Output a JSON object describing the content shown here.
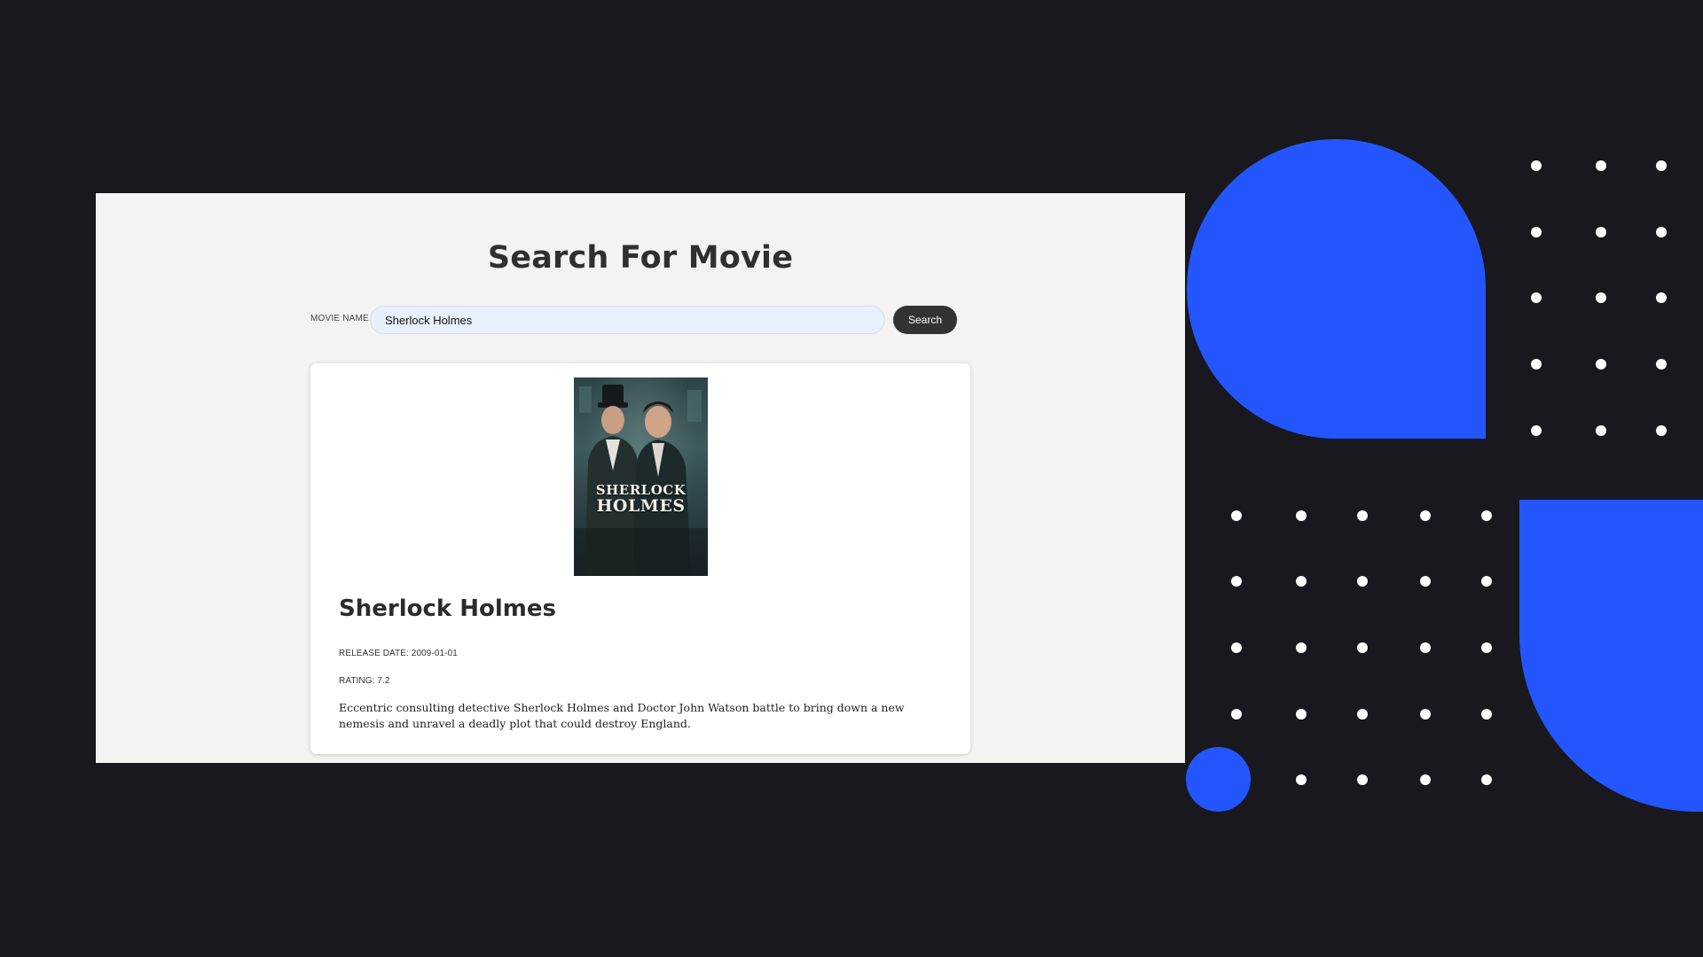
{
  "page": {
    "title": "Search For Movie"
  },
  "search": {
    "label": "MOVIE NAME",
    "value": "Sherlock Holmes",
    "button_label": "Search"
  },
  "result": {
    "poster_title_line1": "SHERLOCK",
    "poster_title_line2": "HOLMES",
    "title": "Sherlock Holmes",
    "release_date": "RELEASE DATE: 2009-01-01",
    "rating": "RATING: 7.2",
    "overview": "Eccentric consulting detective Sherlock Holmes and Doctor John Watson battle to bring down a new nemesis and unravel a deadly plot that could destroy England."
  },
  "colors": {
    "background": "#18181e",
    "accent": "#2356fe",
    "button": "#333333",
    "input_fill": "#e8f0fd"
  }
}
